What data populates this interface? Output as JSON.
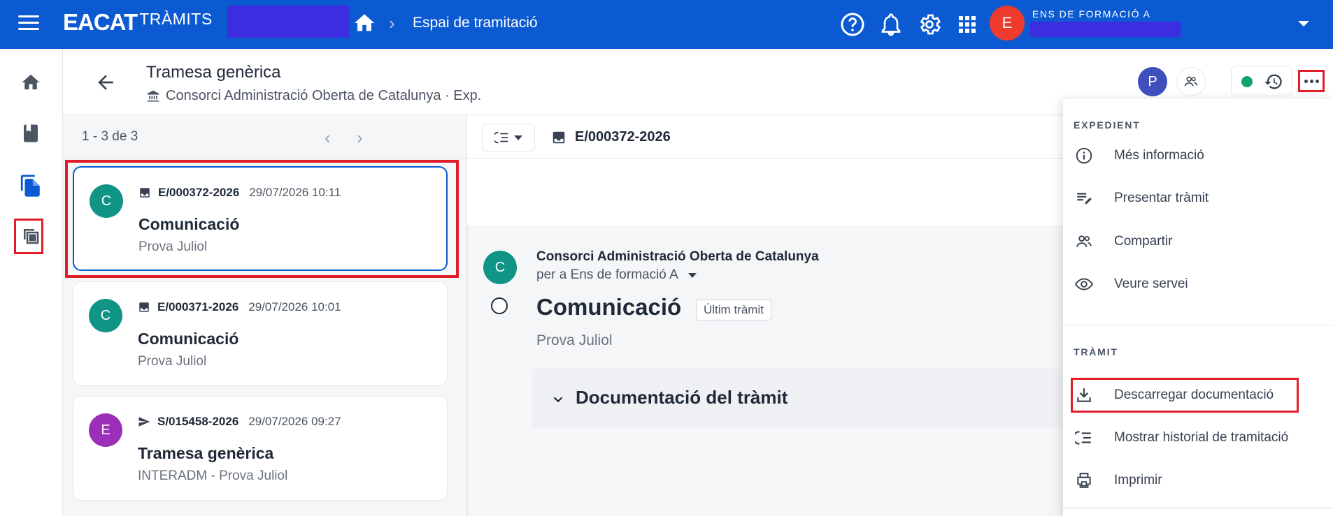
{
  "topbar": {
    "brand_main": "EACAT",
    "brand_sub": "TRÀMITS",
    "breadcrumb_current": "Espai de tramitació",
    "user_org": "ENS DE FORMACIÓ A",
    "user_initial": "E",
    "bg_color": "#0b5ad1",
    "icons": [
      "menu-icon",
      "home-icon",
      "help-icon",
      "bell-icon",
      "gear-icon",
      "apps-grid-icon",
      "chevron-down-icon"
    ]
  },
  "rail": {
    "items": [
      "home-icon",
      "book-icon",
      "documents-icon",
      "copy-icon"
    ],
    "active_index": 2
  },
  "header": {
    "title": "Tramesa genèrica",
    "subtitle": "Consorci Administració Oberta de Catalunya · Exp.",
    "participant_initial": "P",
    "status_color": "#10a36a"
  },
  "list": {
    "count": "1 - 3 de 3",
    "items": [
      {
        "initial": "C",
        "avatar_color": "#0f9486",
        "code": "E/000372-2026",
        "date": "29/07/2026 10:11",
        "title": "Comunicació",
        "subtitle": "Prova Juliol",
        "icon": "inbox-icon"
      },
      {
        "initial": "C",
        "avatar_color": "#0f9486",
        "code": "E/000371-2026",
        "date": "29/07/2026 10:01",
        "title": "Comunicació",
        "subtitle": "Prova Juliol",
        "icon": "inbox-icon"
      },
      {
        "initial": "E",
        "avatar_color": "#9b2fb8",
        "code": "S/015458-2026",
        "date": "29/07/2026 09:27",
        "title": "Tramesa genèrica",
        "subtitle": "INTERADM - Prova Juliol",
        "icon": "send-icon"
      }
    ]
  },
  "detail": {
    "code": "E/000372-2026",
    "sender_initial": "C",
    "from": "Consorci Administració Oberta de Catalunya",
    "to": "per a Ens de formació A",
    "title": "Comunicació",
    "tag": "Últim tràmit",
    "subtitle": "Prova Juliol",
    "doc_section": "Documentació del tràmit"
  },
  "menu": {
    "section1": "EXPEDIENT",
    "section1_items": [
      {
        "label": "Més informació",
        "icon": "info-icon"
      },
      {
        "label": "Presentar tràmit",
        "icon": "edit-list-icon"
      },
      {
        "label": "Compartir",
        "icon": "people-icon"
      },
      {
        "label": "Veure servei",
        "icon": "eye-icon"
      }
    ],
    "section2": "TRÀMIT",
    "section2_items": [
      {
        "label": "Descarregar documentació",
        "icon": "download-icon"
      },
      {
        "label": "Mostrar historial de tramitació",
        "icon": "history-list-icon"
      },
      {
        "label": "Imprimir",
        "icon": "print-icon"
      }
    ]
  },
  "highlight_color": "#e11d2a"
}
